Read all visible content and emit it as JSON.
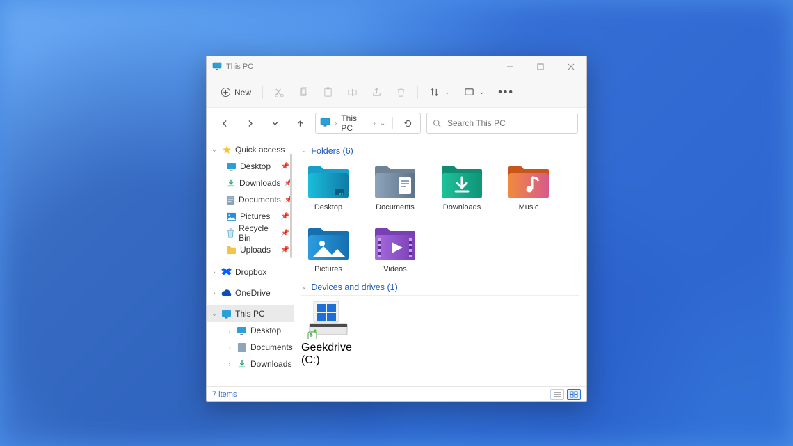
{
  "window": {
    "title": "This PC"
  },
  "wincontrols": {
    "min": "minimize",
    "max": "maximize",
    "close": "close"
  },
  "toolbar": {
    "new_label": "New",
    "cut": "Cut",
    "copy": "Copy",
    "paste": "Paste",
    "rename": "Rename",
    "share": "Share",
    "delete": "Delete",
    "sort": "Sort",
    "view": "View",
    "more": "More"
  },
  "nav": {
    "back": "Back",
    "forward": "Forward",
    "recent": "Recent",
    "up": "Up",
    "breadcrumb": [
      "This PC"
    ],
    "refresh": "Refresh",
    "search_placeholder": "Search This PC"
  },
  "sidebar": {
    "quick_access": {
      "label": "Quick access",
      "expanded": true
    },
    "quick_items": [
      {
        "label": "Desktop",
        "pinned": true,
        "icon": "desktop"
      },
      {
        "label": "Downloads",
        "pinned": true,
        "icon": "downloads"
      },
      {
        "label": "Documents",
        "pinned": true,
        "icon": "documents"
      },
      {
        "label": "Pictures",
        "pinned": true,
        "icon": "pictures"
      },
      {
        "label": "Recycle Bin",
        "pinned": true,
        "icon": "recycle"
      },
      {
        "label": "Uploads",
        "pinned": true,
        "icon": "folder"
      }
    ],
    "dropbox": {
      "label": "Dropbox"
    },
    "onedrive": {
      "label": "OneDrive"
    },
    "this_pc": {
      "label": "This PC",
      "expanded": true,
      "selected": true
    },
    "pc_items": [
      {
        "label": "Desktop",
        "icon": "desktop"
      },
      {
        "label": "Documents",
        "icon": "documents"
      },
      {
        "label": "Downloads",
        "icon": "downloads"
      }
    ]
  },
  "content": {
    "group_folders": {
      "label": "Folders",
      "count": 6
    },
    "folders": [
      {
        "label": "Desktop",
        "icon": "desktop"
      },
      {
        "label": "Documents",
        "icon": "documents"
      },
      {
        "label": "Downloads",
        "icon": "downloads"
      },
      {
        "label": "Music",
        "icon": "music"
      },
      {
        "label": "Pictures",
        "icon": "pictures"
      },
      {
        "label": "Videos",
        "icon": "videos"
      }
    ],
    "group_drives": {
      "label": "Devices and drives",
      "count": 1
    },
    "drives": [
      {
        "label": "Geekdrive (C:)"
      }
    ]
  },
  "status": {
    "items_text": "7 items"
  }
}
